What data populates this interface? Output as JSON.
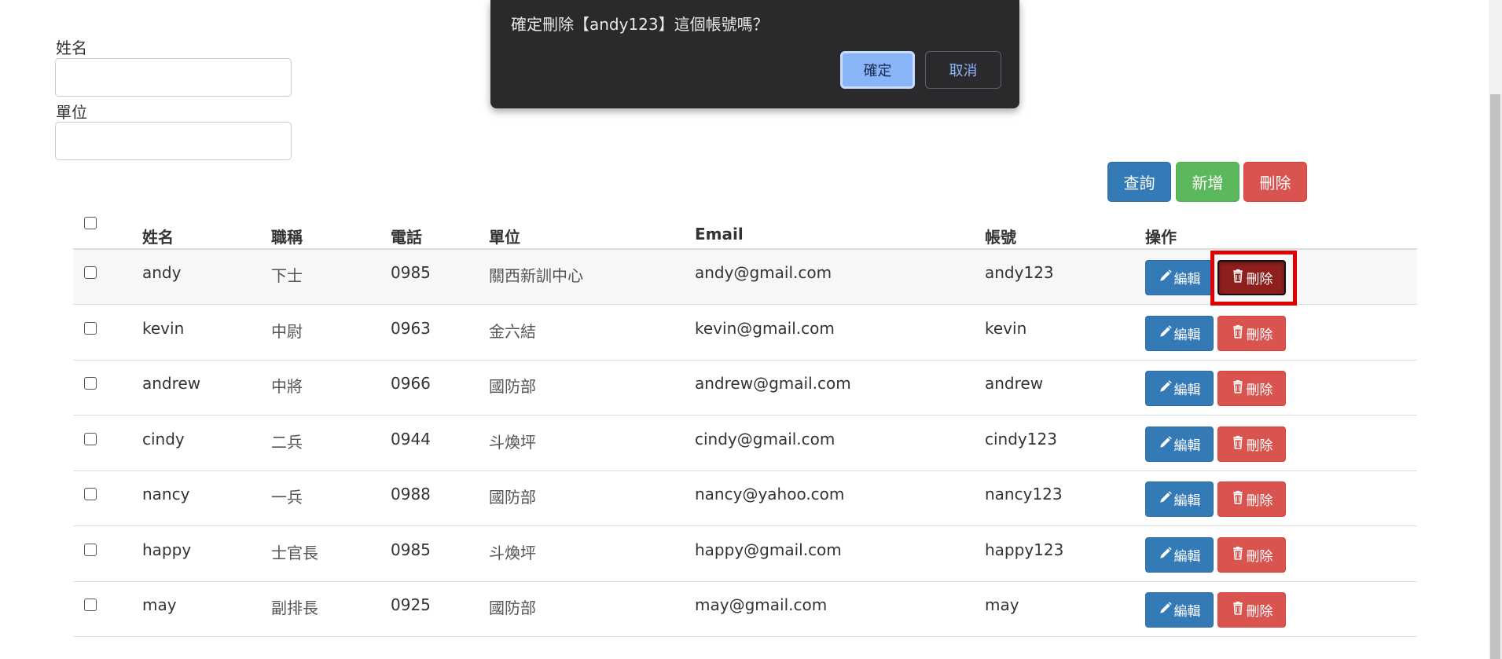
{
  "form": {
    "name_label": "姓名",
    "unit_label": "單位",
    "name_value": "",
    "unit_value": ""
  },
  "actions": {
    "query_label": "查詢",
    "add_label": "新增",
    "delete_label": "刪除"
  },
  "table": {
    "headers": {
      "name": "姓名",
      "title": "職稱",
      "phone": "電話",
      "unit": "單位",
      "email": "Email",
      "account": "帳號",
      "ops": "操作"
    },
    "edit_label": "編輯",
    "delete_label": "刪除",
    "rows": [
      {
        "name": "andy",
        "title": "下士",
        "phone": "0985",
        "unit": "關西新訓中心",
        "email": "andy@gmail.com",
        "account": "andy123"
      },
      {
        "name": "kevin",
        "title": "中尉",
        "phone": "0963",
        "unit": "金六結",
        "email": "kevin@gmail.com",
        "account": "kevin"
      },
      {
        "name": "andrew",
        "title": "中將",
        "phone": "0966",
        "unit": "國防部",
        "email": "andrew@gmail.com",
        "account": "andrew"
      },
      {
        "name": "cindy",
        "title": "二兵",
        "phone": "0944",
        "unit": "斗煥坪",
        "email": "cindy@gmail.com",
        "account": "cindy123"
      },
      {
        "name": "nancy",
        "title": "一兵",
        "phone": "0988",
        "unit": "國防部",
        "email": "nancy@yahoo.com",
        "account": "nancy123"
      },
      {
        "name": "happy",
        "title": "士官長",
        "phone": "0985",
        "unit": "斗煥坪",
        "email": "happy@gmail.com",
        "account": "happy123"
      },
      {
        "name": "may",
        "title": "副排長",
        "phone": "0925",
        "unit": "國防部",
        "email": "may@gmail.com",
        "account": "may"
      }
    ]
  },
  "dialog": {
    "message": "確定刪除【andy123】這個帳號嗎？",
    "ok_label": "確定",
    "cancel_label": "取消"
  },
  "colors": {
    "primary": "#337ab7",
    "success": "#5cb85c",
    "danger": "#d9534f",
    "danger_active": "#8e1f1c",
    "highlight": "#e00000",
    "dialog_bg": "#2a2a2c",
    "dialog_accent": "#8ab4f8"
  },
  "icons": {
    "edit": "pencil-icon",
    "delete": "trash-icon"
  }
}
